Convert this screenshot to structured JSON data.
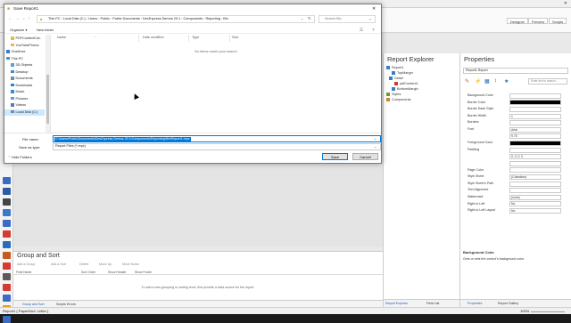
{
  "app": {
    "view_tabs": [
      "Designer",
      "Preview",
      "Scripts"
    ]
  },
  "dialog": {
    "title": "Save Report1",
    "breadcrumb": [
      "This PC",
      "Local Disk (C:)",
      "Users",
      "Public",
      "Public Documents",
      "DevExpress Demos 20.1",
      "Components",
      "Reporting",
      "Bin"
    ],
    "search_placeholder": "Search Bin",
    "organize_label": "Organize ▾",
    "new_folder_label": "New folder",
    "nav_items": [
      {
        "label": "PDFContentCon",
        "icon": "folder-icon",
        "indent": 1,
        "color": "#e8b84a"
      },
      {
        "label": "YouTubePromo",
        "icon": "folder-icon",
        "indent": 1,
        "color": "#e8b84a"
      },
      {
        "label": "OneDrive",
        "icon": "cloud-icon",
        "indent": 0,
        "color": "#2f7fd0"
      },
      {
        "label": "This PC",
        "icon": "computer-icon",
        "indent": 0,
        "color": "#4a90d0"
      },
      {
        "label": "3D Objects",
        "icon": "cube-icon",
        "indent": 1,
        "color": "#5aa0d8"
      },
      {
        "label": "Desktop",
        "icon": "desktop-icon",
        "indent": 1,
        "color": "#3c8ad0"
      },
      {
        "label": "Documents",
        "icon": "documents-icon",
        "indent": 1,
        "color": "#6a8fb0"
      },
      {
        "label": "Downloads",
        "icon": "download-icon",
        "indent": 1,
        "color": "#2f7fd0"
      },
      {
        "label": "Music",
        "icon": "music-icon",
        "indent": 1,
        "color": "#3c8ad0"
      },
      {
        "label": "Pictures",
        "icon": "pictures-icon",
        "indent": 1,
        "color": "#5aa0d8"
      },
      {
        "label": "Videos",
        "icon": "video-icon",
        "indent": 1,
        "color": "#5a78c0"
      },
      {
        "label": "Local Disk (C:)",
        "icon": "drive-icon",
        "indent": 1,
        "color": "#7a8a9a",
        "selected": true
      }
    ],
    "columns": [
      "Name",
      "Date modified",
      "Type",
      "Size"
    ],
    "empty_text": "No items match your search.",
    "filename_label": "File name:",
    "filename_value": "C:\\Users\\Public\\Documents\\DevExpress Demos 20.1\\Components\\Reporting\\Bin\\Report1.repx",
    "savetype_label": "Save as type:",
    "savetype_value": "Report Files (*.repx)",
    "hide_folders_label": "Hide Folders",
    "save_label": "Save",
    "cancel_label": "Cancel"
  },
  "explorer": {
    "title": "Report Explorer",
    "tree": [
      {
        "label": "Report1",
        "indent": 0
      },
      {
        "label": "TopMargin",
        "indent": 2
      },
      {
        "label": "Detail",
        "indent": 1
      },
      {
        "label": "pdfContent1",
        "indent": 3
      },
      {
        "label": "BottomMargin",
        "indent": 2
      },
      {
        "label": "Styles",
        "indent": 0
      },
      {
        "label": "Components",
        "indent": 0
      }
    ],
    "bottom_tabs": [
      "Report Explorer",
      "Field List"
    ]
  },
  "properties": {
    "title": "Properties",
    "selector": "Report1  Report",
    "search_placeholder": "Enter text to search...",
    "rows": [
      {
        "label": "Background Color",
        "value": ""
      },
      {
        "label": "Border Color",
        "value": ""
      },
      {
        "label": "Border Dash Style",
        "value": ""
      },
      {
        "label": "Border Width",
        "value": "1"
      },
      {
        "label": "Borders",
        "value": ""
      },
      {
        "label": "Font",
        "value": "Arial"
      },
      {
        "label": "",
        "value": "9.75"
      },
      {
        "label": "Foreground Color",
        "value": ""
      },
      {
        "label": "Padding",
        "value": ""
      },
      {
        "label": "",
        "value": "0, 0, 0, 0"
      },
      {
        "label": "",
        "value": ""
      },
      {
        "label": "Page Color",
        "value": ""
      },
      {
        "label": "Style Sheet",
        "value": "(Collection)"
      },
      {
        "label": "Style Sheet's Path",
        "value": ""
      },
      {
        "label": "Text Alignment",
        "value": ""
      },
      {
        "label": "Watermark",
        "value": "(none)"
      },
      {
        "label": "Right to Left",
        "value": "No"
      },
      {
        "label": "Right to Left Layout",
        "value": "No"
      }
    ],
    "description_title": "Background Color",
    "description_text": "Gets or sets the control's background color.",
    "bottom_tabs": [
      "Properties",
      "Report Gallery"
    ]
  },
  "group_sort": {
    "title": "Group and Sort",
    "toolbar": [
      "Add a Group",
      "Add a Sort",
      "Delete",
      "Move Up",
      "Move Down"
    ],
    "columns": [
      "Field Name",
      "Sort Order",
      "Show Header",
      "Show Footer"
    ],
    "empty_text": "To add a new grouping or sorting level, first provide a data source for the report.",
    "bottom_tabs": [
      "Group and Sort",
      "Scripts Errors"
    ]
  },
  "status": {
    "text": "Report1 { PaperKind: Letter }",
    "zoom": "100%"
  }
}
